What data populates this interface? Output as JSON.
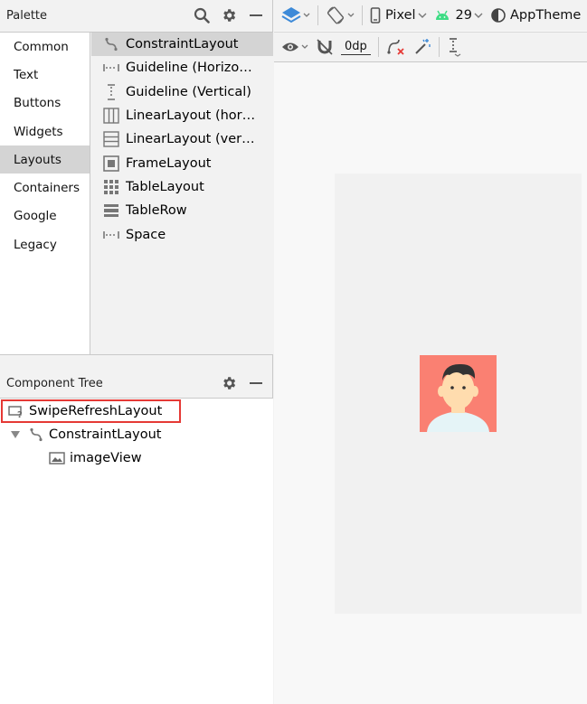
{
  "palette": {
    "title": "Palette",
    "categories": [
      "Common",
      "Text",
      "Buttons",
      "Widgets",
      "Layouts",
      "Containers",
      "Google",
      "Legacy"
    ],
    "selected_category": "Layouts",
    "items": [
      {
        "label": "ConstraintLayout",
        "icon": "constraint-layout-icon"
      },
      {
        "label": "Guideline (Horizo…",
        "icon": "guideline-horizontal-icon"
      },
      {
        "label": "Guideline (Vertical)",
        "icon": "guideline-vertical-icon"
      },
      {
        "label": "LinearLayout (hor…",
        "icon": "linear-layout-horizontal-icon"
      },
      {
        "label": "LinearLayout (ver…",
        "icon": "linear-layout-vertical-icon"
      },
      {
        "label": "FrameLayout",
        "icon": "frame-layout-icon"
      },
      {
        "label": "TableLayout",
        "icon": "table-layout-icon"
      },
      {
        "label": "TableRow",
        "icon": "table-row-icon"
      },
      {
        "label": "Space",
        "icon": "space-icon"
      }
    ]
  },
  "component_tree": {
    "title": "Component Tree",
    "nodes": [
      {
        "label": "SwipeRefreshLayout",
        "icon": "swipe-refresh-layout-icon"
      },
      {
        "label": "ConstraintLayout",
        "icon": "constraint-layout-icon"
      },
      {
        "label": "imageView",
        "icon": "image-icon"
      }
    ]
  },
  "toolbar": {
    "device": "Pixel",
    "api_level": "29",
    "theme": "AppTheme",
    "default_margin": "0dp"
  },
  "colors": {
    "highlight": "#e53935",
    "accent": "#3d8ad8",
    "android_green": "#3ddc84",
    "avatar_bg": "#fa8072"
  }
}
